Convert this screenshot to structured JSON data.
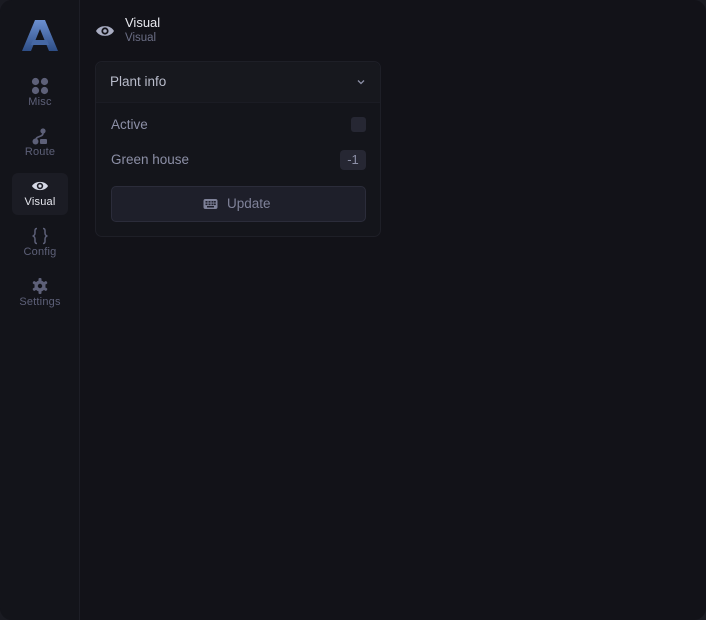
{
  "sidebar": {
    "items": [
      {
        "label": "Misc",
        "icon": "grid-icon"
      },
      {
        "label": "Route",
        "icon": "route-icon"
      },
      {
        "label": "Visual",
        "icon": "eye-icon",
        "active": true
      },
      {
        "label": "Config",
        "icon": "braces-icon"
      },
      {
        "label": "Settings",
        "icon": "gear-icon"
      }
    ]
  },
  "header": {
    "title": "Visual",
    "subtitle": "Visual",
    "icon": "eye-icon"
  },
  "panel": {
    "title": "Plant info",
    "fields": {
      "active": {
        "label": "Active",
        "checked": false
      },
      "green_house": {
        "label": "Green house",
        "value": "-1"
      }
    },
    "update_label": "Update"
  },
  "colors": {
    "background": "#121218",
    "sidebar": "#13141a",
    "accent_logo": "#4a6ea8",
    "text_primary": "#e8e9ef",
    "text_muted": "#8c8fa6"
  }
}
